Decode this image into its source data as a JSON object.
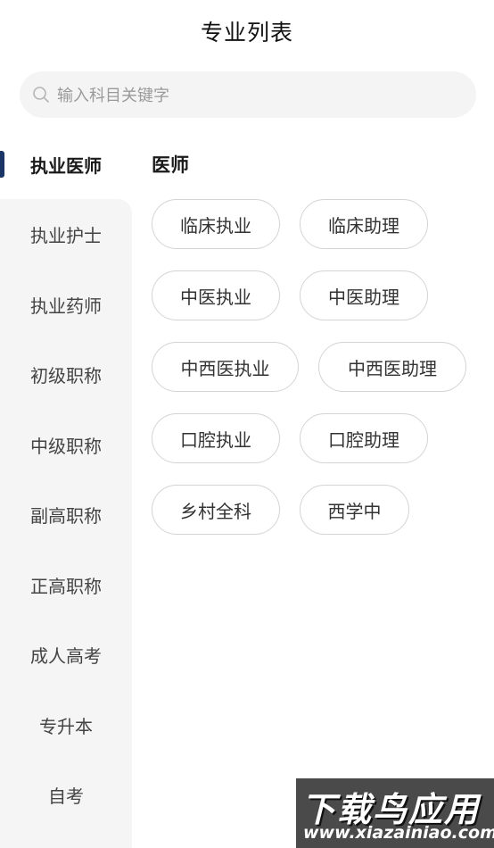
{
  "header": {
    "title": "专业列表"
  },
  "search": {
    "placeholder": "输入科目关键字",
    "icon": "search-icon"
  },
  "sidebar": {
    "items": [
      {
        "label": "执业医师",
        "active": true
      },
      {
        "label": "执业护士"
      },
      {
        "label": "执业药师"
      },
      {
        "label": "初级职称"
      },
      {
        "label": "中级职称"
      },
      {
        "label": "副高职称"
      },
      {
        "label": "正高职称"
      },
      {
        "label": "成人高考"
      },
      {
        "label": "专升本"
      },
      {
        "label": "自考"
      }
    ]
  },
  "content": {
    "section_title": "医师",
    "tags": [
      "临床执业",
      "临床助理",
      "中医执业",
      "中医助理",
      "中西医执业",
      "中西医助理",
      "口腔执业",
      "口腔助理",
      "乡村全科",
      "西学中"
    ]
  },
  "watermark": {
    "line1": "下载鸟应用",
    "line2": "www.xiazainiao.com"
  },
  "colors": {
    "accent": "#1a3566",
    "sidebar_bg": "#f5f5f5",
    "tag_border": "#d4d4d4"
  }
}
